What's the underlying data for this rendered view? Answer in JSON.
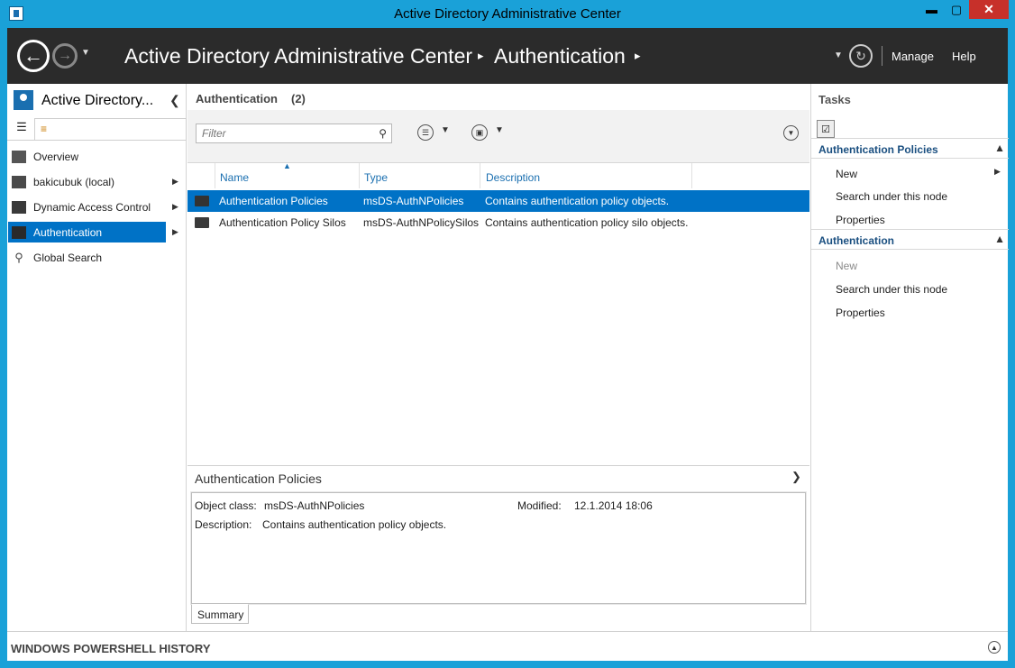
{
  "window": {
    "title": "Active Directory Administrative Center",
    "minimize": "▬",
    "maximize": "▢",
    "close": "✕"
  },
  "header": {
    "breadcrumb": [
      "Active Directory Administrative Center",
      "Authentication"
    ],
    "separator": "▸",
    "manage": "Manage",
    "help": "Help"
  },
  "nav": {
    "title": "Active Directory...",
    "items": [
      {
        "label": "Overview",
        "icon": "overview-icon",
        "arrow": false,
        "selected": false
      },
      {
        "label": "bakicubuk (local)",
        "icon": "domain-icon",
        "arrow": true,
        "selected": false
      },
      {
        "label": "Dynamic Access Control",
        "icon": "folder-icon",
        "arrow": true,
        "selected": false
      },
      {
        "label": "Authentication",
        "icon": "folder-icon",
        "arrow": true,
        "selected": true
      },
      {
        "label": "Global Search",
        "icon": "search-icon",
        "arrow": false,
        "selected": false
      }
    ]
  },
  "main": {
    "title": "Authentication",
    "count": "(2)",
    "filter_placeholder": "Filter",
    "columns": [
      "Name",
      "Type",
      "Description"
    ],
    "rows": [
      {
        "name": "Authentication Policies",
        "type": "msDS-AuthNPolicies",
        "description": "Contains authentication policy objects.",
        "selected": true
      },
      {
        "name": "Authentication Policy Silos",
        "type": "msDS-AuthNPolicySilos",
        "description": "Contains authentication policy silo objects.",
        "selected": false
      }
    ]
  },
  "preview": {
    "title": "Authentication Policies",
    "object_class_label": "Object class:",
    "object_class_value": "msDS-AuthNPolicies",
    "modified_label": "Modified:",
    "modified_value": "12.1.2014 18:06",
    "description_label": "Description:",
    "description_value": "Contains authentication policy objects.",
    "tab": "Summary"
  },
  "tasks": {
    "title": "Tasks",
    "sections": [
      {
        "title": "Authentication Policies",
        "items": [
          {
            "label": "New",
            "disabled": false
          },
          {
            "label": "Search under this node",
            "disabled": false
          },
          {
            "label": "Properties",
            "disabled": false
          }
        ]
      },
      {
        "title": "Authentication",
        "items": [
          {
            "label": "New",
            "disabled": true
          },
          {
            "label": "Search under this node",
            "disabled": false
          },
          {
            "label": "Properties",
            "disabled": false
          }
        ]
      }
    ]
  },
  "powershell": {
    "title": "WINDOWS POWERSHELL HISTORY"
  },
  "colors": {
    "frame": "#1aa1d8",
    "header": "#2b2b2b",
    "selection": "#0072c6",
    "close": "#c7302a"
  }
}
